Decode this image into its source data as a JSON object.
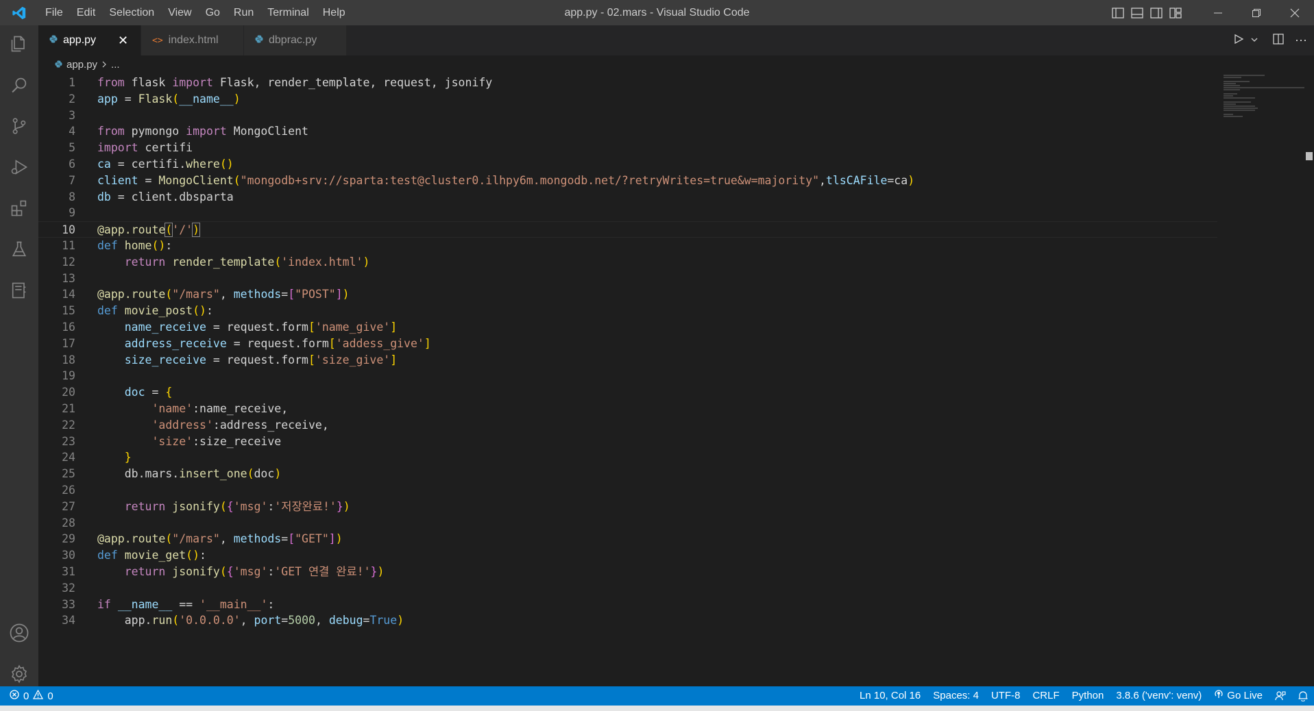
{
  "window": {
    "title": "app.py - 02.mars - Visual Studio Code",
    "menu": [
      "File",
      "Edit",
      "Selection",
      "View",
      "Go",
      "Run",
      "Terminal",
      "Help"
    ]
  },
  "tabs": [
    {
      "label": "app.py",
      "icon": "python-icon",
      "active": true
    },
    {
      "label": "index.html",
      "icon": "html-icon",
      "active": false
    },
    {
      "label": "dbprac.py",
      "icon": "python-icon",
      "active": false
    }
  ],
  "breadcrumb": {
    "file": "app.py",
    "more": "..."
  },
  "editor": {
    "current_line": 10,
    "line_numbers": [
      "1",
      "2",
      "3",
      "4",
      "5",
      "6",
      "7",
      "8",
      "9",
      "10",
      "11",
      "12",
      "13",
      "14",
      "15",
      "16",
      "17",
      "18",
      "19",
      "20",
      "21",
      "22",
      "23",
      "24",
      "25",
      "26",
      "27",
      "28",
      "29",
      "30",
      "31",
      "32",
      "33",
      "34"
    ],
    "lines": [
      "from flask import Flask, render_template, request, jsonify",
      "app = Flask(__name__)",
      "",
      "from pymongo import MongoClient",
      "import certifi",
      "ca = certifi.where()",
      "client = MongoClient(\"mongodb+srv://sparta:test@cluster0.ilhpy6m.mongodb.net/?retryWrites=true&w=majority\",tlsCAFile=ca)",
      "db = client.dbsparta",
      "",
      "@app.route('/')",
      "def home():",
      "    return render_template('index.html')",
      "",
      "@app.route(\"/mars\", methods=[\"POST\"])",
      "def movie_post():",
      "    name_receive = request.form['name_give']",
      "    address_receive = request.form['addess_give']",
      "    size_receive = request.form['size_give']",
      "",
      "    doc = {",
      "        'name':name_receive,",
      "        'address':address_receive,",
      "        'size':size_receive",
      "    }",
      "    db.mars.insert_one(doc)",
      "",
      "    return jsonify({'msg':'저장완료!'})",
      "",
      "@app.route(\"/mars\", methods=[\"GET\"])",
      "def movie_get():",
      "    return jsonify({'msg':'GET 연결 완료!'})",
      "",
      "if __name__ == '__main__':",
      "    app.run('0.0.0.0', port=5000, debug=True)"
    ]
  },
  "statusbar": {
    "errors": "0",
    "warnings": "0",
    "position": "Ln 10, Col 16",
    "spaces": "Spaces: 4",
    "encoding": "UTF-8",
    "eol": "CRLF",
    "language": "Python",
    "interpreter": "3.8.6 ('venv': venv)",
    "golive": "Go Live"
  },
  "colors": {
    "statusbar": "#007acc",
    "titlebar": "#3c3c3c",
    "editor_bg": "#1e1e1e",
    "keyword": "#c586c0",
    "string": "#ce9178",
    "function": "#dcdcaa"
  }
}
